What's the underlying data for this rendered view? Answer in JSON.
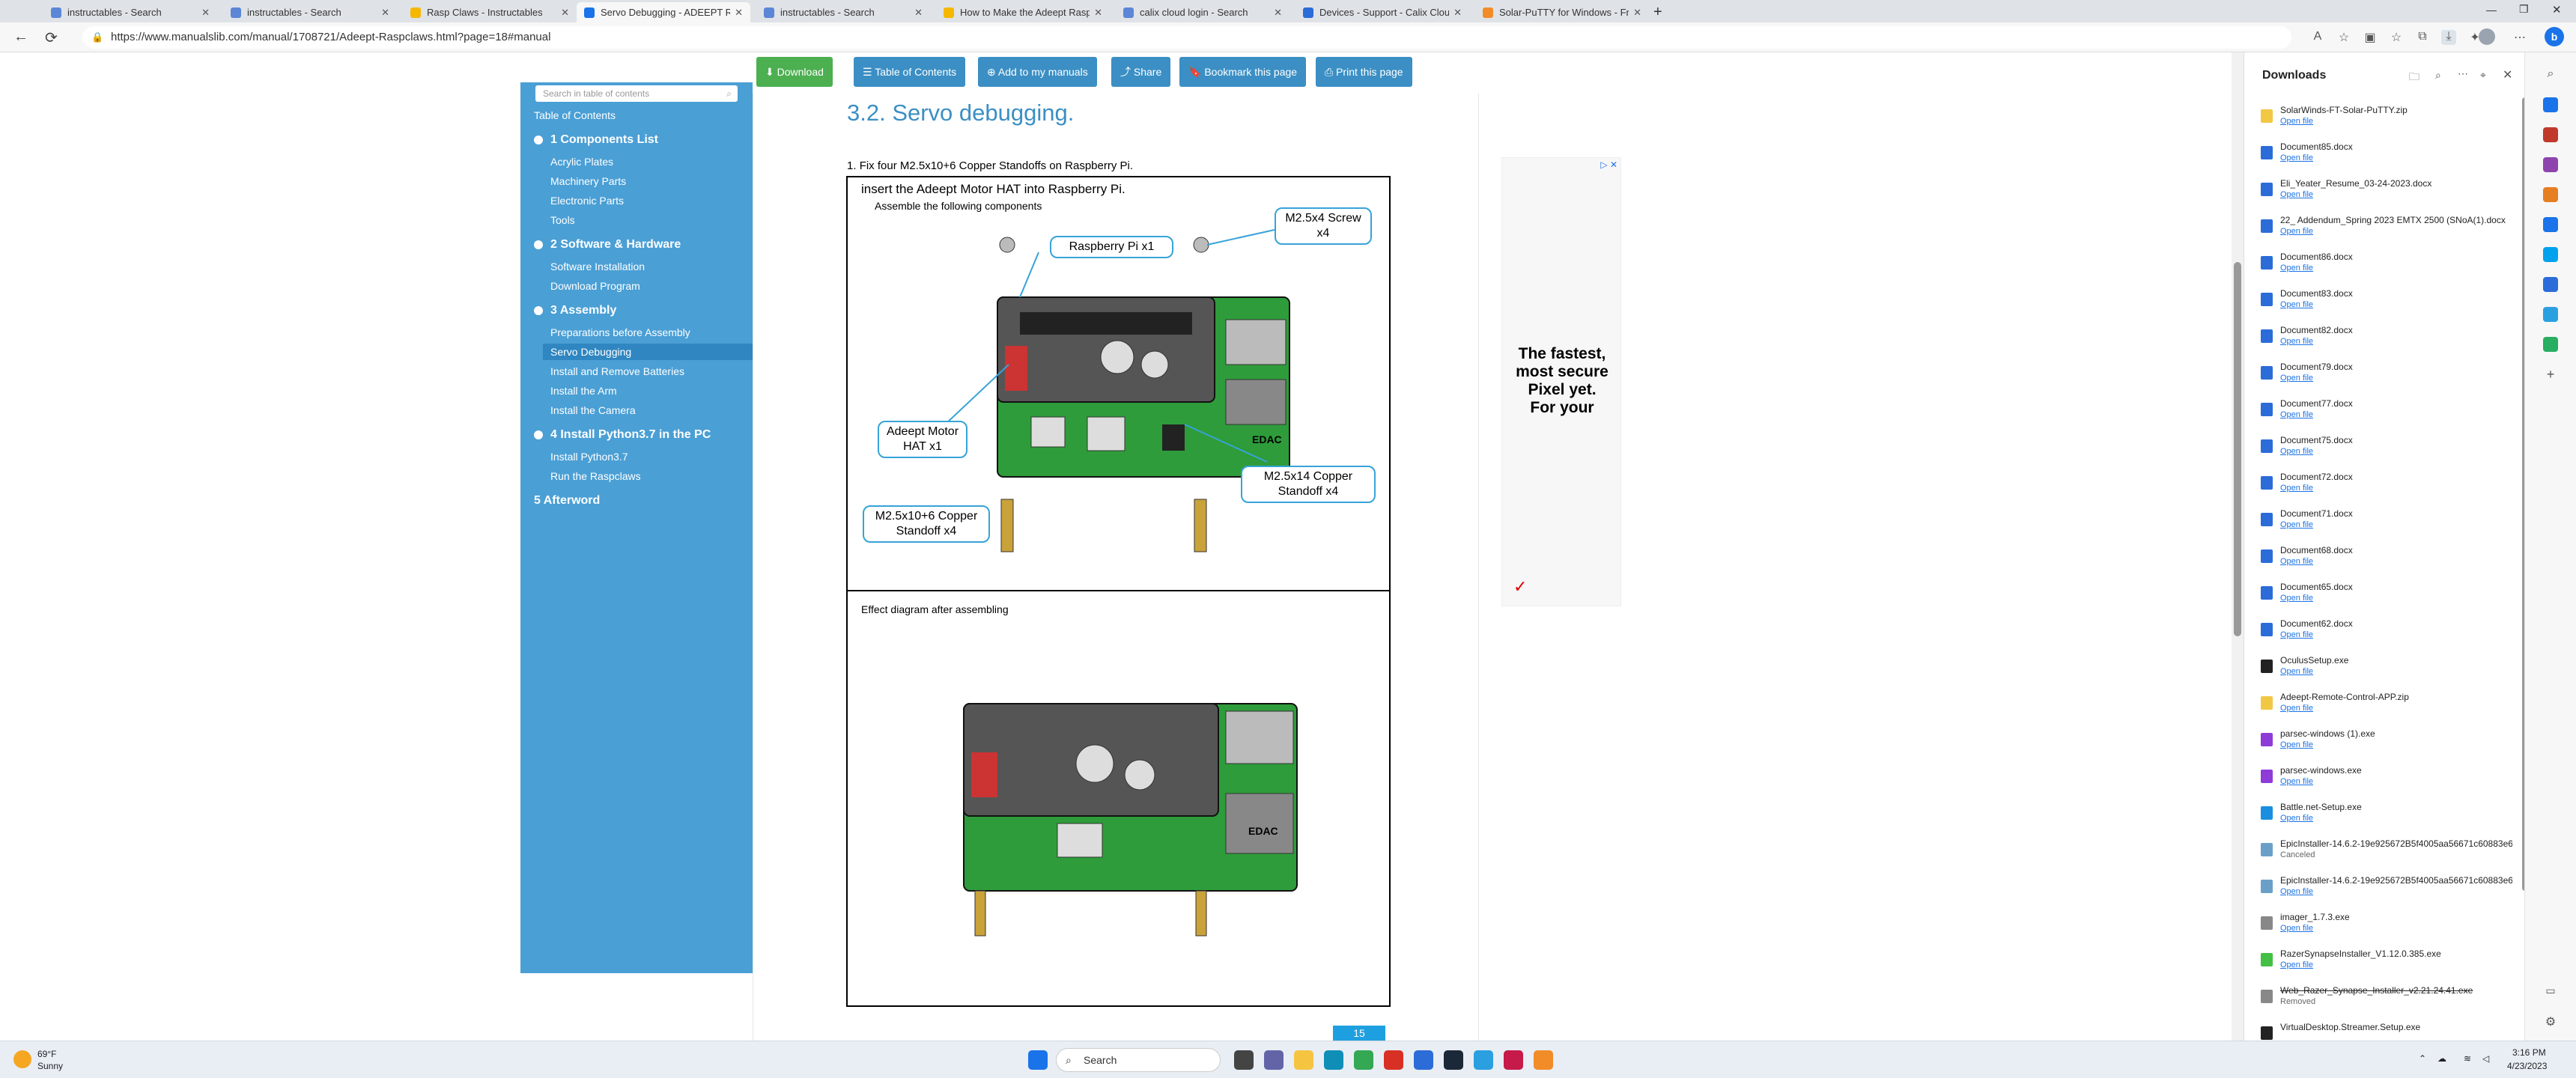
{
  "tabs": [
    {
      "label": "instructables - Search",
      "color": "#5c86d6"
    },
    {
      "label": "instructables - Search",
      "color": "#5c86d6"
    },
    {
      "label": "Rasp Claws - Instructables",
      "color": "#f5b700"
    },
    {
      "label": "Servo Debugging - ADEEPT Rasp",
      "color": "#1a73e8"
    },
    {
      "label": "instructables - Search",
      "color": "#5c86d6"
    },
    {
      "label": "How to Make the Adeept Rasp",
      "color": "#f5b700"
    },
    {
      "label": "calix cloud login - Search",
      "color": "#5c86d6"
    },
    {
      "label": "Devices - Support - Calix Cloud",
      "color": "#2b6cd8"
    },
    {
      "label": "Solar-PuTTY for Windows - Free",
      "color": "#f28c28"
    }
  ],
  "url": "https://www.manualslib.com/manual/1708721/Adeept-Raspclaws.html?page=18#manual",
  "toolbar": {
    "download": "Download",
    "toc": "Table of Contents",
    "add": "Add to my manuals",
    "share": "Share",
    "bookmark": "Bookmark this page",
    "print": "Print this page"
  },
  "sidebar": {
    "search_placeholder": "Search in table of contents",
    "toc_label": "Table of Contents",
    "sections": [
      {
        "title": "1 Components List",
        "items": [
          "Acrylic Plates",
          "Machinery Parts",
          "Electronic Parts",
          "Tools"
        ]
      },
      {
        "title": "2 Software & Hardware",
        "items": [
          "Software Installation",
          "Download Program"
        ]
      },
      {
        "title": "3 Assembly",
        "items": [
          "Preparations before Assembly",
          "Servo Debugging",
          "Install and Remove Batteries",
          "Install the Arm",
          "Install the Camera"
        ]
      },
      {
        "title": "4 Install Python3.7 in the PC",
        "items": [
          "Install Python3.7",
          "Run the Raspclaws"
        ]
      },
      {
        "title": "5 Afterword",
        "items": []
      }
    ]
  },
  "doc": {
    "title": "3.2. Servo debugging.",
    "step_num": "1.",
    "step": "Fix four M2.5x10+6 Copper Standoffs on Raspberry Pi.",
    "box1_line1": "insert the Adeept Motor HAT into Raspberry Pi.",
    "box1_line2": "Assemble the following components",
    "labels": {
      "pi": "Raspberry Pi x1",
      "screw": "M2.5x4 Screw x4",
      "hat": "Adeept Motor HAT x1",
      "copper14": "M2.5x14 Copper Standoff x4",
      "copper10": "M2.5x10+6 Copper Standoff x4"
    },
    "box2_label": "Effect diagram after assembling",
    "page_number": "15",
    "edac": "EDAC"
  },
  "ad": {
    "text": "The fastest, most secure Pixel yet. For your"
  },
  "downloads": {
    "title": "Downloads",
    "items": [
      {
        "name": "SolarWinds-FT-Solar-PuTTY.zip",
        "status": "Open file",
        "color": "#f2c744"
      },
      {
        "name": "Document85.docx",
        "status": "Open file",
        "color": "#2b6cd8"
      },
      {
        "name": "Eli_Yeater_Resume_03-24-2023.docx",
        "status": "Open file",
        "color": "#2b6cd8"
      },
      {
        "name": "22_ Addendum_Spring 2023 EMTX 2500 (SNoA(1).docx",
        "status": "Open file",
        "color": "#2b6cd8"
      },
      {
        "name": "Document86.docx",
        "status": "Open file",
        "color": "#2b6cd8"
      },
      {
        "name": "Document83.docx",
        "status": "Open file",
        "color": "#2b6cd8"
      },
      {
        "name": "Document82.docx",
        "status": "Open file",
        "color": "#2b6cd8"
      },
      {
        "name": "Document79.docx",
        "status": "Open file",
        "color": "#2b6cd8"
      },
      {
        "name": "Document77.docx",
        "status": "Open file",
        "color": "#2b6cd8"
      },
      {
        "name": "Document75.docx",
        "status": "Open file",
        "color": "#2b6cd8"
      },
      {
        "name": "Document72.docx",
        "status": "Open file",
        "color": "#2b6cd8"
      },
      {
        "name": "Document71.docx",
        "status": "Open file",
        "color": "#2b6cd8"
      },
      {
        "name": "Document68.docx",
        "status": "Open file",
        "color": "#2b6cd8"
      },
      {
        "name": "Document65.docx",
        "status": "Open file",
        "color": "#2b6cd8"
      },
      {
        "name": "Document62.docx",
        "status": "Open file",
        "color": "#2b6cd8"
      },
      {
        "name": "OculusSetup.exe",
        "status": "Open file",
        "color": "#222"
      },
      {
        "name": "Adeept-Remote-Control-APP.zip",
        "status": "Open file",
        "color": "#f2c744"
      },
      {
        "name": "parsec-windows (1).exe",
        "status": "Open file",
        "color": "#8e3bd8"
      },
      {
        "name": "parsec-windows.exe",
        "status": "Open file",
        "color": "#8e3bd8"
      },
      {
        "name": "Battle.net-Setup.exe",
        "status": "Open file",
        "color": "#1a8fe0"
      },
      {
        "name": "EpicInstaller-14.6.2-19e925672B5f4005aa56671c60883e6...",
        "status": "Canceled",
        "color": "#6aa0c8"
      },
      {
        "name": "EpicInstaller-14.6.2-19e925672B5f4005aa56671c60883e6...",
        "status": "Open file",
        "color": "#6aa0c8"
      },
      {
        "name": "imager_1.7.3.exe",
        "status": "Open file",
        "color": "#888"
      },
      {
        "name": "RazerSynapseInstaller_V1.12.0.385.exe",
        "status": "Open file",
        "color": "#44c044"
      },
      {
        "name": "Web_Razer_Synapse_Installer_v2.21.24.41.exe",
        "status": "Removed",
        "color": "#888"
      },
      {
        "name": "VirtualDesktop.Streamer.Setup.exe",
        "status": "",
        "color": "#222"
      }
    ]
  },
  "taskbar": {
    "weather_temp": "69°F",
    "weather_cond": "Sunny",
    "search": "Search",
    "time": "3:16 PM",
    "date": "4/23/2023"
  }
}
